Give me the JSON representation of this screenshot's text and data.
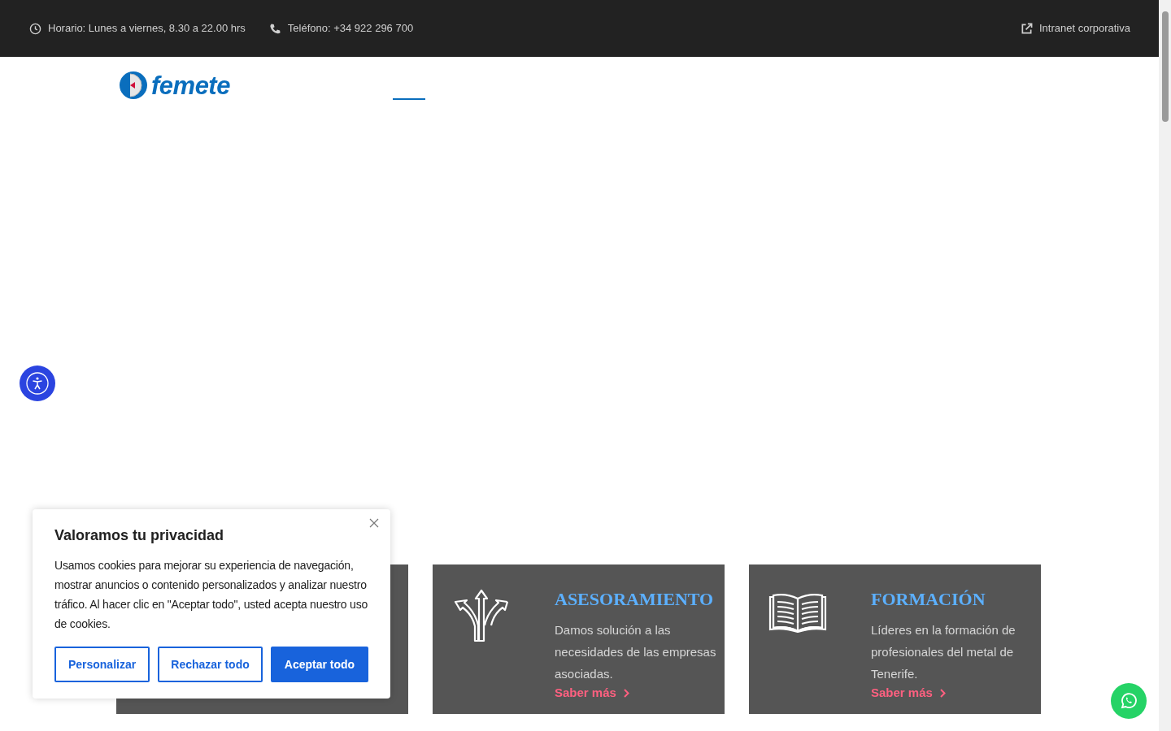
{
  "top_bar": {
    "schedule": "Horario: Lunes a viernes, 8.30 a 22.00 hrs",
    "phone": "Teléfono: +34 922 296 700",
    "intranet_link": "Intranet corporativa"
  },
  "header": {
    "logo_text": "femete"
  },
  "cards": [
    {
      "kind": "covered"
    },
    {
      "kind": "directions",
      "title": "ASESORAMIENTO",
      "text": "Damos solución a las necesidades de las empresas asociadas.",
      "link": "Saber más"
    },
    {
      "kind": "book",
      "title": "FORMACIÓN",
      "text": "Líderes en la formación de profesionales del metal de Tenerife.",
      "link": "Saber más"
    }
  ],
  "cookie_dialog": {
    "title": "Valoramos tu privacidad",
    "text": "Usamos cookies para mejorar su experiencia de navegación, mostrar anuncios o contenido personalizados y analizar nuestro tráfico. Al hacer clic en \"Aceptar todo\", usted acepta nuestro uso de cookies.",
    "buttons": [
      {
        "label": "Personalizar",
        "kind": "outline"
      },
      {
        "label": "Rechazar todo",
        "kind": "outline"
      },
      {
        "label": "Aceptar todo",
        "kind": "primary"
      }
    ]
  }
}
